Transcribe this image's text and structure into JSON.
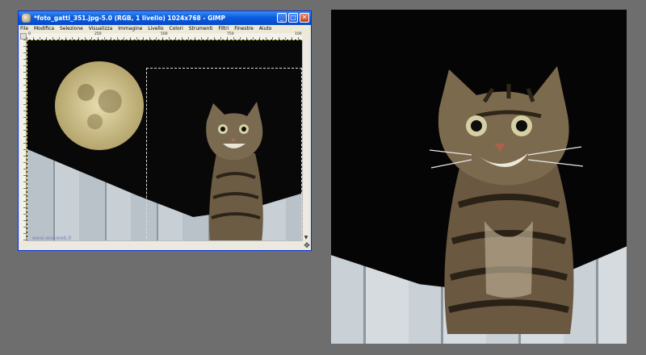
{
  "window": {
    "title": "*foto_gatti_351.jpg-5.0 (RGB, 1 livello) 1024x768 - GIMP",
    "minimize_glyph": "_",
    "maximize_glyph": "□",
    "close_glyph": "✕"
  },
  "menu": {
    "items": [
      "File",
      "Modifica",
      "Selezione",
      "Visualizza",
      "Immagine",
      "Livello",
      "Colori",
      "Strumenti",
      "Filtri",
      "Finestre",
      "Aiuto"
    ]
  },
  "ruler": {
    "ticks": [
      "0",
      "250",
      "500",
      "750",
      "100"
    ]
  },
  "canvas": {
    "watermark": "www.wowweb.it"
  },
  "scroll": {
    "down_glyph": "▼",
    "nav_glyph": "✥"
  },
  "colors": {
    "titlebar": "#0a5de0",
    "selection_marching_ants": "#e8e040",
    "background": "#6e6e6e"
  }
}
